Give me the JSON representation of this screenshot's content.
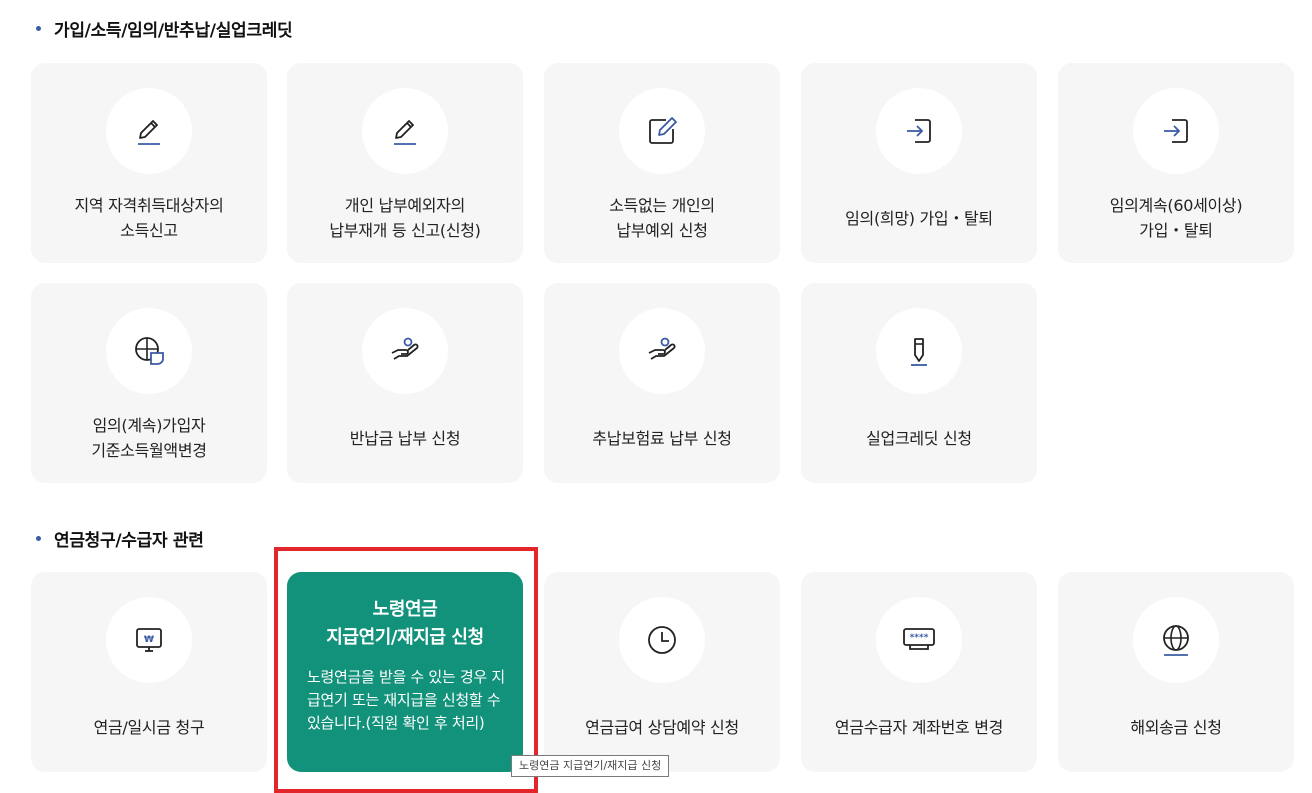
{
  "sections": [
    {
      "title": "가입/소득/임의/반추납/실업크레딧",
      "cards": [
        {
          "label": "지역 자격취득대상자의\n소득신고",
          "icon": "pencil-icon"
        },
        {
          "label": "개인 납부예외자의\n납부재개 등 신고(신청)",
          "icon": "pencil-icon"
        },
        {
          "label": "소득없는 개인의\n납부예외 신청",
          "icon": "edit-square-icon"
        },
        {
          "label": "임의(희망) 가입・탈퇴",
          "icon": "sign-in-icon"
        },
        {
          "label": "임의계속(60세이상)\n가입・탈퇴",
          "icon": "sign-in-icon"
        },
        {
          "label": "임의(계속)가입자\n기준소득월액변경",
          "icon": "globe-shield-icon"
        },
        {
          "label": "반납금 납부 신청",
          "icon": "hand-person-icon"
        },
        {
          "label": "추납보험료 납부 신청",
          "icon": "hand-person-icon"
        },
        {
          "label": "실업크레딧 신청",
          "icon": "pen-icon"
        }
      ]
    },
    {
      "title": "연금청구/수급자 관련",
      "cards": [
        {
          "label": "연금/일시금 청구",
          "icon": "monitor-won-icon"
        },
        {
          "title": "노령연금\n지급연기/재지급 신청",
          "desc": "노령연금을 받을 수 있는 경우 지급연기 또는 재지급을 신청할 수 있습니다.(직원 확인 후 처리)",
          "icon": "none",
          "state": "hovered"
        },
        {
          "label": "연금급여 상담예약 신청",
          "icon": "clock-icon"
        },
        {
          "label": "연금수급자 계좌번호 변경",
          "icon": "password-monitor-icon"
        },
        {
          "label": "해외송금 신청",
          "icon": "globe-icon"
        }
      ]
    }
  ],
  "tooltip": "노령연금 지급연기/재지급 신청",
  "colors": {
    "accent": "#13927b",
    "card_bg": "#f6f6f6",
    "icon_blue": "#3b5ba5",
    "highlight": "#e3262b"
  }
}
